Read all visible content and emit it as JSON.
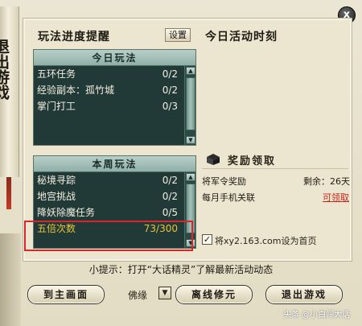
{
  "window": {
    "close_label": "x",
    "scroll_text": "退出游戏"
  },
  "progress_panel": {
    "title": "玩法进度提醒",
    "settings_label": "设置"
  },
  "today_activity": {
    "title": "今日活动时刻"
  },
  "daily_list": {
    "header": "今日玩法",
    "items": [
      {
        "name": "五环任务",
        "value": "0/2"
      },
      {
        "name": "经验副本：孤竹城",
        "value": "0/2"
      },
      {
        "name": "掌门打工",
        "value": "0/3"
      }
    ]
  },
  "weekly_list": {
    "header": "本周玩法",
    "items": [
      {
        "name": "秘境寻踪",
        "value": "0/2"
      },
      {
        "name": "地宫挑战",
        "value": "0/2"
      },
      {
        "name": "降妖除魔任务",
        "value": "0/5"
      },
      {
        "name": "五倍次数",
        "value": "73/300"
      }
    ]
  },
  "rewards": {
    "title": "奖励领取",
    "rows": [
      {
        "name": "将军令奖励",
        "status": "剩余：26天"
      },
      {
        "name": "每月手机关联",
        "status": "可领取"
      }
    ]
  },
  "homepage": {
    "checked": true,
    "label": "将xy2.163.com设为首页"
  },
  "tip": "小提示：打开“大话精灵”了解最新活动动态",
  "buttons": {
    "main_screen": "到主画面",
    "mode_label": "佛缘",
    "offline": "离线修元",
    "exit": "退出游戏"
  },
  "watermark": "头条 @小白闯大话",
  "colors": {
    "highlight_text": "#e8c33a",
    "list_bg": "#223a37",
    "annotation_box": "#d9262a",
    "claim_link": "#c6261a"
  }
}
